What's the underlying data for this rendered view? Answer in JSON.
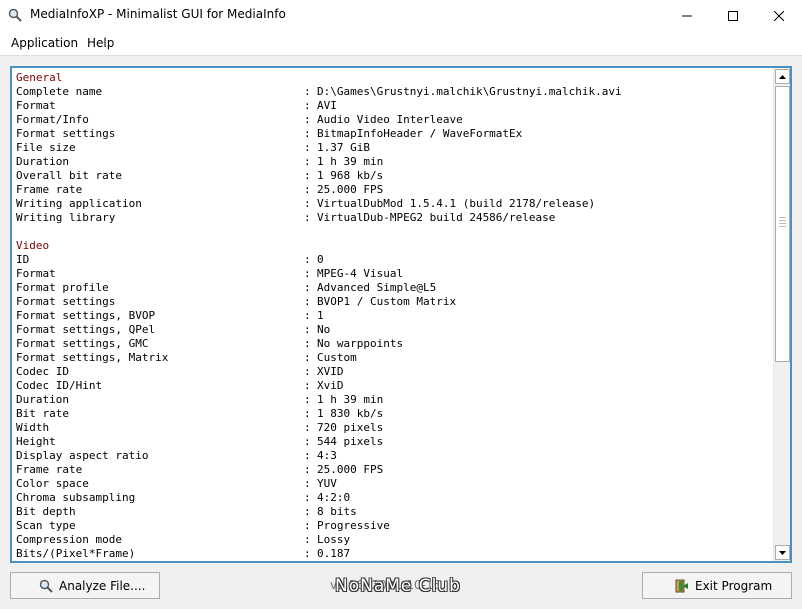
{
  "window": {
    "title": "MediaInfoXP - Minimalist GUI for MediaInfo",
    "app_icon": "magnifier-icon"
  },
  "menu": {
    "items": [
      "Application",
      "Help"
    ]
  },
  "report": {
    "general": {
      "heading": "General",
      "rows": [
        [
          "Complete name",
          "D:\\Games\\Grustnyi.malchik\\Grustnyi.malchik.avi"
        ],
        [
          "Format",
          "AVI"
        ],
        [
          "Format/Info",
          "Audio Video Interleave"
        ],
        [
          "Format settings",
          "BitmapInfoHeader / WaveFormatEx"
        ],
        [
          "File size",
          "1.37 GiB"
        ],
        [
          "Duration",
          "1 h 39 min"
        ],
        [
          "Overall bit rate",
          "1 968 kb/s"
        ],
        [
          "Frame rate",
          "25.000 FPS"
        ],
        [
          "Writing application",
          "VirtualDubMod 1.5.4.1 (build 2178/release)"
        ],
        [
          "Writing library",
          "VirtualDub-MPEG2 build 24586/release"
        ]
      ]
    },
    "video": {
      "heading": "Video",
      "rows": [
        [
          "ID",
          "0"
        ],
        [
          "Format",
          "MPEG-4 Visual"
        ],
        [
          "Format profile",
          "Advanced Simple@L5"
        ],
        [
          "Format settings",
          "BVOP1 / Custom Matrix"
        ],
        [
          "Format settings, BVOP",
          "1"
        ],
        [
          "Format settings, QPel",
          "No"
        ],
        [
          "Format settings, GMC",
          "No warppoints"
        ],
        [
          "Format settings, Matrix",
          "Custom"
        ],
        [
          "Codec ID",
          "XVID"
        ],
        [
          "Codec ID/Hint",
          "XviD"
        ],
        [
          "Duration",
          "1 h 39 min"
        ],
        [
          "Bit rate",
          "1 830 kb/s"
        ],
        [
          "Width",
          "720 pixels"
        ],
        [
          "Height",
          "544 pixels"
        ],
        [
          "Display aspect ratio",
          "4:3"
        ],
        [
          "Frame rate",
          "25.000 FPS"
        ],
        [
          "Color space",
          "YUV"
        ],
        [
          "Chroma subsampling",
          "4:2:0"
        ],
        [
          "Bit depth",
          "8 bits"
        ],
        [
          "Scan type",
          "Progressive"
        ],
        [
          "Compression mode",
          "Lossy"
        ],
        [
          "Bits/(Pixel*Frame)",
          "0.187"
        ]
      ]
    },
    "separator": ":"
  },
  "footer": {
    "analyze_label": "Analyze File....",
    "exit_label": "Exit Program",
    "version_text": "v1.16, 2021-10-15",
    "watermark": "NoNaMe Club"
  },
  "colors": {
    "section_heading": "#7f0000",
    "report_border": "#4a90c0"
  }
}
